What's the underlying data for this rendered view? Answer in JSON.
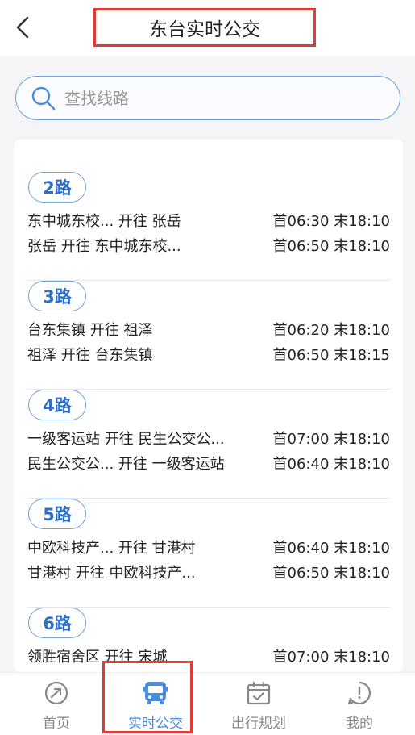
{
  "header": {
    "title": "东台实时公交",
    "back_icon": "chevron-left-icon"
  },
  "search": {
    "placeholder": "查找线路",
    "icon": "search-icon"
  },
  "routes": [
    {
      "name": "2路",
      "directions": [
        {
          "label": "东中城东校... 开往 张岳",
          "time": "首06:30 末18:10"
        },
        {
          "label": "张岳 开往 东中城东校...",
          "time": "首06:50 末18:10"
        }
      ]
    },
    {
      "name": "3路",
      "directions": [
        {
          "label": "台东集镇 开往 祖泽",
          "time": "首06:20 末18:10"
        },
        {
          "label": "祖泽 开往 台东集镇",
          "time": "首06:50 末18:15"
        }
      ]
    },
    {
      "name": "4路",
      "directions": [
        {
          "label": "一级客运站 开往 民生公交公...",
          "time": "首07:00 末18:10"
        },
        {
          "label": "民生公交公... 开往 一级客运站",
          "time": "首06:40 末18:10"
        }
      ]
    },
    {
      "name": "5路",
      "directions": [
        {
          "label": "中欧科技产... 开往 甘港村",
          "time": "首06:40 末18:10"
        },
        {
          "label": "甘港村 开往 中欧科技产...",
          "time": "首06:50 末18:10"
        }
      ]
    },
    {
      "name": "6路",
      "directions": [
        {
          "label": "领胜宿舍区 开往 宋城",
          "time": "首07:00 末18:10"
        }
      ]
    }
  ],
  "tabbar": {
    "items": [
      {
        "label": "首页",
        "icon": "home-icon",
        "active": false
      },
      {
        "label": "实时公交",
        "icon": "bus-icon",
        "active": true
      },
      {
        "label": "出行规划",
        "icon": "calendar-check-icon",
        "active": false
      },
      {
        "label": "我的",
        "icon": "profile-icon",
        "active": false
      }
    ]
  },
  "colors": {
    "accent": "#4a8de0",
    "badge_text": "#2e6fc9",
    "highlight": "#e53935",
    "background": "#f5f5f7"
  }
}
